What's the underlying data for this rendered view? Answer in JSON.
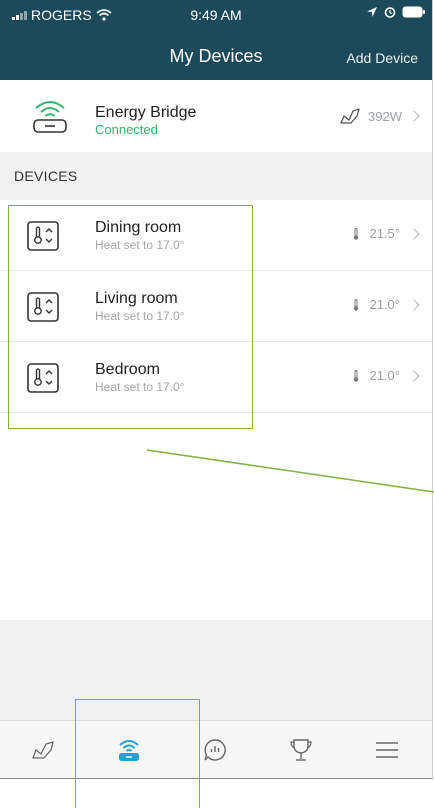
{
  "status_bar": {
    "carrier": "ROGERS",
    "time": "9:49 AM"
  },
  "nav": {
    "title": "My Devices",
    "add_button": "Add Device"
  },
  "energy_bridge": {
    "name": "Energy Bridge",
    "status": "Connected",
    "power": "392W"
  },
  "section_header": "DEVICES",
  "devices": [
    {
      "name": "Dining room",
      "setting": "Heat set to 17.0°",
      "temperature": "21.5°"
    },
    {
      "name": "Living room",
      "setting": "Heat set to 17.0°",
      "temperature": "21.0°"
    },
    {
      "name": "Bedroom",
      "setting": "Heat set to 17.0°",
      "temperature": "21.0°"
    }
  ],
  "tab_bar": {
    "tabs": [
      "usage-icon",
      "devices-icon",
      "insights-icon",
      "trophy-icon",
      "menu-icon"
    ],
    "selected_index": 1
  },
  "colors": {
    "header_bg": "#1c4a5c",
    "accent": "#2a9fd0",
    "connected": "#39b26b",
    "annotation": "#7fb241"
  }
}
